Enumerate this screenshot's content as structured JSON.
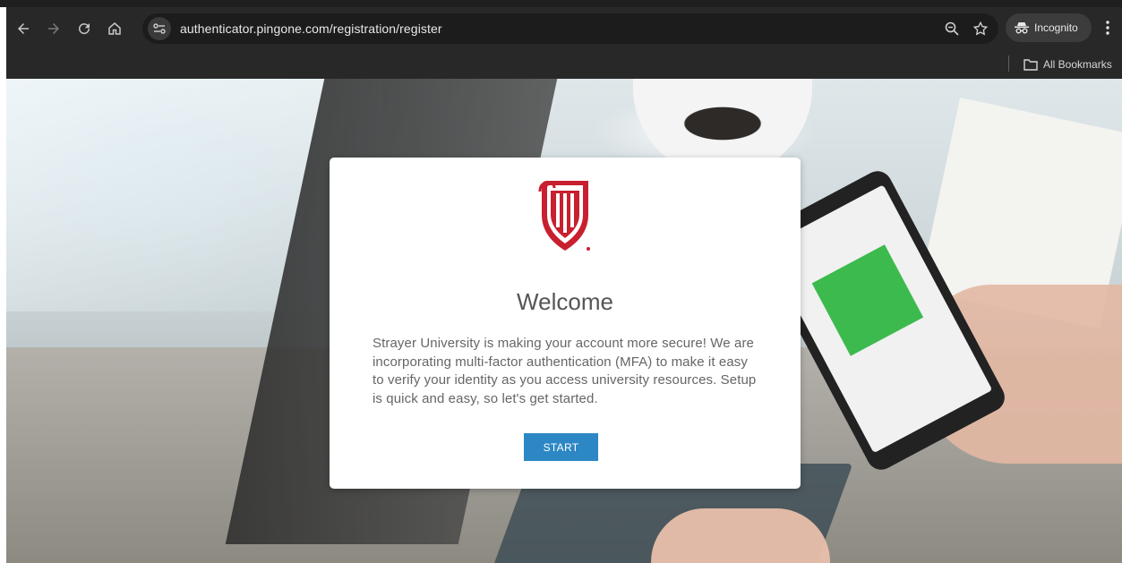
{
  "browser": {
    "url": "authenticator.pingone.com/registration/register",
    "incognito_label": "Incognito",
    "bookmarks_label": "All Bookmarks"
  },
  "page": {
    "heading": "Welcome",
    "message": "Strayer University is making your account more secure! We are incorporating multi-factor authentication (MFA) to make it easy to verify your identity as you access university resources. Setup is quick and easy, so let's get started.",
    "start_button": "START"
  },
  "colors": {
    "accent": "#2d87c5",
    "logo_red": "#c8202f",
    "toolbar": "#282828"
  },
  "icons": [
    "back-arrow-icon",
    "forward-arrow-icon",
    "reload-icon",
    "home-icon",
    "site-info-icon",
    "zoom-icon",
    "star-icon",
    "incognito-icon",
    "kebab-menu-icon",
    "folder-icon"
  ]
}
